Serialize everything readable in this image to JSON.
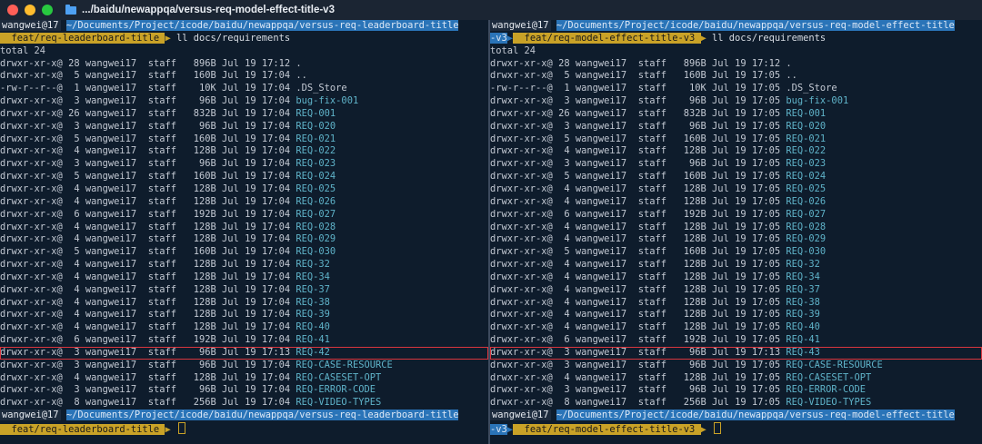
{
  "window": {
    "title": ".../baidu/newappqa/versus-req-model-effect-title-v3"
  },
  "left": {
    "top_prompt": {
      "user": "wangwei@17",
      "path": "~/Documents/Project/icode/baidu/newappqa/versus-req-leaderboard-title",
      "git_glyph": "",
      "branch": "feat/req-leaderboard-title",
      "command": "ll docs/requirements"
    },
    "total": "total 24",
    "rows": [
      {
        "perm": "drwxr-xr-x@",
        "links": "28",
        "owner": "wangwei17",
        "group": "staff",
        "size": "896B",
        "date": "Jul 19 17:12",
        "name": "."
      },
      {
        "perm": "drwxr-xr-x@",
        "links": "5",
        "owner": "wangwei17",
        "group": "staff",
        "size": "160B",
        "date": "Jul 19 17:04",
        "name": ".."
      },
      {
        "perm": "-rw-r--r--@",
        "links": "1",
        "owner": "wangwei17",
        "group": "staff",
        "size": "10K",
        "date": "Jul 19 17:04",
        "name": ".DS_Store"
      },
      {
        "perm": "drwxr-xr-x@",
        "links": "3",
        "owner": "wangwei17",
        "group": "staff",
        "size": "96B",
        "date": "Jul 19 17:04",
        "name": "bug-fix-001"
      },
      {
        "perm": "drwxr-xr-x@",
        "links": "26",
        "owner": "wangwei17",
        "group": "staff",
        "size": "832B",
        "date": "Jul 19 17:04",
        "name": "REQ-001"
      },
      {
        "perm": "drwxr-xr-x@",
        "links": "3",
        "owner": "wangwei17",
        "group": "staff",
        "size": "96B",
        "date": "Jul 19 17:04",
        "name": "REQ-020"
      },
      {
        "perm": "drwxr-xr-x@",
        "links": "5",
        "owner": "wangwei17",
        "group": "staff",
        "size": "160B",
        "date": "Jul 19 17:04",
        "name": "REQ-021"
      },
      {
        "perm": "drwxr-xr-x@",
        "links": "4",
        "owner": "wangwei17",
        "group": "staff",
        "size": "128B",
        "date": "Jul 19 17:04",
        "name": "REQ-022"
      },
      {
        "perm": "drwxr-xr-x@",
        "links": "3",
        "owner": "wangwei17",
        "group": "staff",
        "size": "96B",
        "date": "Jul 19 17:04",
        "name": "REQ-023"
      },
      {
        "perm": "drwxr-xr-x@",
        "links": "5",
        "owner": "wangwei17",
        "group": "staff",
        "size": "160B",
        "date": "Jul 19 17:04",
        "name": "REQ-024"
      },
      {
        "perm": "drwxr-xr-x@",
        "links": "4",
        "owner": "wangwei17",
        "group": "staff",
        "size": "128B",
        "date": "Jul 19 17:04",
        "name": "REQ-025"
      },
      {
        "perm": "drwxr-xr-x@",
        "links": "4",
        "owner": "wangwei17",
        "group": "staff",
        "size": "128B",
        "date": "Jul 19 17:04",
        "name": "REQ-026"
      },
      {
        "perm": "drwxr-xr-x@",
        "links": "6",
        "owner": "wangwei17",
        "group": "staff",
        "size": "192B",
        "date": "Jul 19 17:04",
        "name": "REQ-027"
      },
      {
        "perm": "drwxr-xr-x@",
        "links": "4",
        "owner": "wangwei17",
        "group": "staff",
        "size": "128B",
        "date": "Jul 19 17:04",
        "name": "REQ-028"
      },
      {
        "perm": "drwxr-xr-x@",
        "links": "4",
        "owner": "wangwei17",
        "group": "staff",
        "size": "128B",
        "date": "Jul 19 17:04",
        "name": "REQ-029"
      },
      {
        "perm": "drwxr-xr-x@",
        "links": "5",
        "owner": "wangwei17",
        "group": "staff",
        "size": "160B",
        "date": "Jul 19 17:04",
        "name": "REQ-030"
      },
      {
        "perm": "drwxr-xr-x@",
        "links": "4",
        "owner": "wangwei17",
        "group": "staff",
        "size": "128B",
        "date": "Jul 19 17:04",
        "name": "REQ-32"
      },
      {
        "perm": "drwxr-xr-x@",
        "links": "4",
        "owner": "wangwei17",
        "group": "staff",
        "size": "128B",
        "date": "Jul 19 17:04",
        "name": "REQ-34"
      },
      {
        "perm": "drwxr-xr-x@",
        "links": "4",
        "owner": "wangwei17",
        "group": "staff",
        "size": "128B",
        "date": "Jul 19 17:04",
        "name": "REQ-37"
      },
      {
        "perm": "drwxr-xr-x@",
        "links": "4",
        "owner": "wangwei17",
        "group": "staff",
        "size": "128B",
        "date": "Jul 19 17:04",
        "name": "REQ-38"
      },
      {
        "perm": "drwxr-xr-x@",
        "links": "4",
        "owner": "wangwei17",
        "group": "staff",
        "size": "128B",
        "date": "Jul 19 17:04",
        "name": "REQ-39"
      },
      {
        "perm": "drwxr-xr-x@",
        "links": "4",
        "owner": "wangwei17",
        "group": "staff",
        "size": "128B",
        "date": "Jul 19 17:04",
        "name": "REQ-40"
      },
      {
        "perm": "drwxr-xr-x@",
        "links": "6",
        "owner": "wangwei17",
        "group": "staff",
        "size": "192B",
        "date": "Jul 19 17:04",
        "name": "REQ-41"
      },
      {
        "perm": "drwxr-xr-x@",
        "links": "3",
        "owner": "wangwei17",
        "group": "staff",
        "size": "96B",
        "date": "Jul 19 17:13",
        "name": "REQ-42",
        "highlight": true
      },
      {
        "perm": "drwxr-xr-x@",
        "links": "3",
        "owner": "wangwei17",
        "group": "staff",
        "size": "96B",
        "date": "Jul 19 17:04",
        "name": "REQ-CASE-RESOURCE"
      },
      {
        "perm": "drwxr-xr-x@",
        "links": "4",
        "owner": "wangwei17",
        "group": "staff",
        "size": "128B",
        "date": "Jul 19 17:04",
        "name": "REQ-CASESET-OPT"
      },
      {
        "perm": "drwxr-xr-x@",
        "links": "3",
        "owner": "wangwei17",
        "group": "staff",
        "size": "96B",
        "date": "Jul 19 17:04",
        "name": "REQ-ERROR-CODE"
      },
      {
        "perm": "drwxr-xr-x@",
        "links": "8",
        "owner": "wangwei17",
        "group": "staff",
        "size": "256B",
        "date": "Jul 19 17:04",
        "name": "REQ-VIDEO-TYPES"
      }
    ],
    "bottom_prompt": {
      "user": "wangwei@17",
      "path": "~/Documents/Project/icode/baidu/newappqa/versus-req-leaderboard-title",
      "git_glyph": "",
      "branch": "feat/req-leaderboard-title"
    }
  },
  "right": {
    "top_prompt": {
      "user": "wangwei@17",
      "path": "~/Documents/Project/icode/baidu/newappqa/versus-req-model-effect-title",
      "path_wrap": "-v3",
      "git_glyph": "",
      "branch": "feat/req-model-effect-title-v3",
      "command": "ll docs/requirements"
    },
    "total": "total 24",
    "rows": [
      {
        "perm": "drwxr-xr-x@",
        "links": "28",
        "owner": "wangwei17",
        "group": "staff",
        "size": "896B",
        "date": "Jul 19 17:12",
        "name": "."
      },
      {
        "perm": "drwxr-xr-x@",
        "links": "5",
        "owner": "wangwei17",
        "group": "staff",
        "size": "160B",
        "date": "Jul 19 17:05",
        "name": ".."
      },
      {
        "perm": "-rw-r--r--@",
        "links": "1",
        "owner": "wangwei17",
        "group": "staff",
        "size": "10K",
        "date": "Jul 19 17:05",
        "name": ".DS_Store"
      },
      {
        "perm": "drwxr-xr-x@",
        "links": "3",
        "owner": "wangwei17",
        "group": "staff",
        "size": "96B",
        "date": "Jul 19 17:05",
        "name": "bug-fix-001"
      },
      {
        "perm": "drwxr-xr-x@",
        "links": "26",
        "owner": "wangwei17",
        "group": "staff",
        "size": "832B",
        "date": "Jul 19 17:05",
        "name": "REQ-001"
      },
      {
        "perm": "drwxr-xr-x@",
        "links": "3",
        "owner": "wangwei17",
        "group": "staff",
        "size": "96B",
        "date": "Jul 19 17:05",
        "name": "REQ-020"
      },
      {
        "perm": "drwxr-xr-x@",
        "links": "5",
        "owner": "wangwei17",
        "group": "staff",
        "size": "160B",
        "date": "Jul 19 17:05",
        "name": "REQ-021"
      },
      {
        "perm": "drwxr-xr-x@",
        "links": "4",
        "owner": "wangwei17",
        "group": "staff",
        "size": "128B",
        "date": "Jul 19 17:05",
        "name": "REQ-022"
      },
      {
        "perm": "drwxr-xr-x@",
        "links": "3",
        "owner": "wangwei17",
        "group": "staff",
        "size": "96B",
        "date": "Jul 19 17:05",
        "name": "REQ-023"
      },
      {
        "perm": "drwxr-xr-x@",
        "links": "5",
        "owner": "wangwei17",
        "group": "staff",
        "size": "160B",
        "date": "Jul 19 17:05",
        "name": "REQ-024"
      },
      {
        "perm": "drwxr-xr-x@",
        "links": "4",
        "owner": "wangwei17",
        "group": "staff",
        "size": "128B",
        "date": "Jul 19 17:05",
        "name": "REQ-025"
      },
      {
        "perm": "drwxr-xr-x@",
        "links": "4",
        "owner": "wangwei17",
        "group": "staff",
        "size": "128B",
        "date": "Jul 19 17:05",
        "name": "REQ-026"
      },
      {
        "perm": "drwxr-xr-x@",
        "links": "6",
        "owner": "wangwei17",
        "group": "staff",
        "size": "192B",
        "date": "Jul 19 17:05",
        "name": "REQ-027"
      },
      {
        "perm": "drwxr-xr-x@",
        "links": "4",
        "owner": "wangwei17",
        "group": "staff",
        "size": "128B",
        "date": "Jul 19 17:05",
        "name": "REQ-028"
      },
      {
        "perm": "drwxr-xr-x@",
        "links": "4",
        "owner": "wangwei17",
        "group": "staff",
        "size": "128B",
        "date": "Jul 19 17:05",
        "name": "REQ-029"
      },
      {
        "perm": "drwxr-xr-x@",
        "links": "5",
        "owner": "wangwei17",
        "group": "staff",
        "size": "160B",
        "date": "Jul 19 17:05",
        "name": "REQ-030"
      },
      {
        "perm": "drwxr-xr-x@",
        "links": "4",
        "owner": "wangwei17",
        "group": "staff",
        "size": "128B",
        "date": "Jul 19 17:05",
        "name": "REQ-32"
      },
      {
        "perm": "drwxr-xr-x@",
        "links": "4",
        "owner": "wangwei17",
        "group": "staff",
        "size": "128B",
        "date": "Jul 19 17:05",
        "name": "REQ-34"
      },
      {
        "perm": "drwxr-xr-x@",
        "links": "4",
        "owner": "wangwei17",
        "group": "staff",
        "size": "128B",
        "date": "Jul 19 17:05",
        "name": "REQ-37"
      },
      {
        "perm": "drwxr-xr-x@",
        "links": "4",
        "owner": "wangwei17",
        "group": "staff",
        "size": "128B",
        "date": "Jul 19 17:05",
        "name": "REQ-38"
      },
      {
        "perm": "drwxr-xr-x@",
        "links": "4",
        "owner": "wangwei17",
        "group": "staff",
        "size": "128B",
        "date": "Jul 19 17:05",
        "name": "REQ-39"
      },
      {
        "perm": "drwxr-xr-x@",
        "links": "4",
        "owner": "wangwei17",
        "group": "staff",
        "size": "128B",
        "date": "Jul 19 17:05",
        "name": "REQ-40"
      },
      {
        "perm": "drwxr-xr-x@",
        "links": "6",
        "owner": "wangwei17",
        "group": "staff",
        "size": "192B",
        "date": "Jul 19 17:05",
        "name": "REQ-41"
      },
      {
        "perm": "drwxr-xr-x@",
        "links": "3",
        "owner": "wangwei17",
        "group": "staff",
        "size": "96B",
        "date": "Jul 19 17:13",
        "name": "REQ-43",
        "highlight": true
      },
      {
        "perm": "drwxr-xr-x@",
        "links": "3",
        "owner": "wangwei17",
        "group": "staff",
        "size": "96B",
        "date": "Jul 19 17:05",
        "name": "REQ-CASE-RESOURCE"
      },
      {
        "perm": "drwxr-xr-x@",
        "links": "4",
        "owner": "wangwei17",
        "group": "staff",
        "size": "128B",
        "date": "Jul 19 17:05",
        "name": "REQ-CASESET-OPT"
      },
      {
        "perm": "drwxr-xr-x@",
        "links": "3",
        "owner": "wangwei17",
        "group": "staff",
        "size": "96B",
        "date": "Jul 19 17:05",
        "name": "REQ-ERROR-CODE"
      },
      {
        "perm": "drwxr-xr-x@",
        "links": "8",
        "owner": "wangwei17",
        "group": "staff",
        "size": "256B",
        "date": "Jul 19 17:05",
        "name": "REQ-VIDEO-TYPES"
      }
    ],
    "bottom_prompt": {
      "user": "wangwei@17",
      "path": "~/Documents/Project/icode/baidu/newappqa/versus-req-model-effect-title",
      "path_wrap": "-v3",
      "git_glyph": "",
      "branch": "feat/req-model-effect-title-v3"
    }
  },
  "colors": {
    "background": "#0e1c2c",
    "prompt_user_bg": "#1d2b3d",
    "prompt_path_bg": "#2a74b8",
    "prompt_branch_bg": "#c9a227",
    "dir_name": "#5fb3c9",
    "highlight_box": "#d9363e"
  },
  "icons": {
    "close": "close-dot",
    "minimize": "minimize-dot",
    "zoom": "zoom-dot",
    "folder": "folder-icon"
  }
}
